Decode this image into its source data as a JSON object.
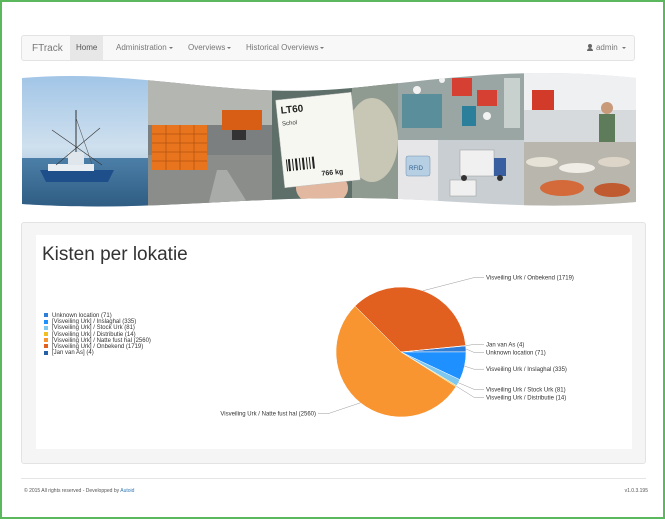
{
  "navbar": {
    "brand": "FTrack",
    "items": [
      {
        "label": "Home",
        "active": true
      },
      {
        "label": "Administration",
        "dropdown": true
      },
      {
        "label": "Overviews",
        "dropdown": true
      },
      {
        "label": "Historical Overviews",
        "dropdown": true
      }
    ],
    "user": "admin"
  },
  "banner": {
    "photos": [
      "fishing-boat-photo",
      "crate-warehouse-photo",
      "crate-label-photo",
      "fish-processing-photo",
      "trucks-rfid-photo",
      "fish-market-photo"
    ],
    "label_card": {
      "code": "LT60",
      "name": "Schol",
      "weight": "766 kg"
    },
    "rfid": "RFID"
  },
  "chart_data": {
    "type": "pie",
    "title": "Kisten per lokatie",
    "legend_position": "left",
    "slices": [
      {
        "legend": "Unknown location (71)",
        "label": "Unknown location (71)",
        "value": 71,
        "color": "#2f7ed8"
      },
      {
        "legend": "[Visveiling Urk] / Inslaghal (335)",
        "label": "Visveiling Urk / Inslaghal (335)",
        "value": 335,
        "color": "#1e90ff"
      },
      {
        "legend": "[Visveiling Urk] / Stock Urk (81)",
        "label": "Visveiling Urk / Stock Urk (81)",
        "value": 81,
        "color": "#7ec8f0"
      },
      {
        "legend": "[Visveiling Urk] / Distributie (14)",
        "label": "Visveiling Urk / Distributie (14)",
        "value": 14,
        "color": "#f0c020"
      },
      {
        "legend": "[Visveiling Urk] / Natte fust hal (2560)",
        "label": "Visveiling Urk / Natte fust hal (2560)",
        "value": 2560,
        "color": "#f89530"
      },
      {
        "legend": "[Visveiling Urk] / Onbekend (1719)",
        "label": "Visveiling Urk / Onbekend (1719)",
        "value": 1719,
        "color": "#e2601f"
      },
      {
        "legend": "[Jan van As] (4)",
        "label": "Jan van As (4)",
        "value": 4,
        "color": "#2460a7"
      }
    ]
  },
  "footer": {
    "prefix": "© 2015 All rights reserved - Developped by ",
    "link": "Autoid",
    "version": "v1.0.3.195"
  }
}
